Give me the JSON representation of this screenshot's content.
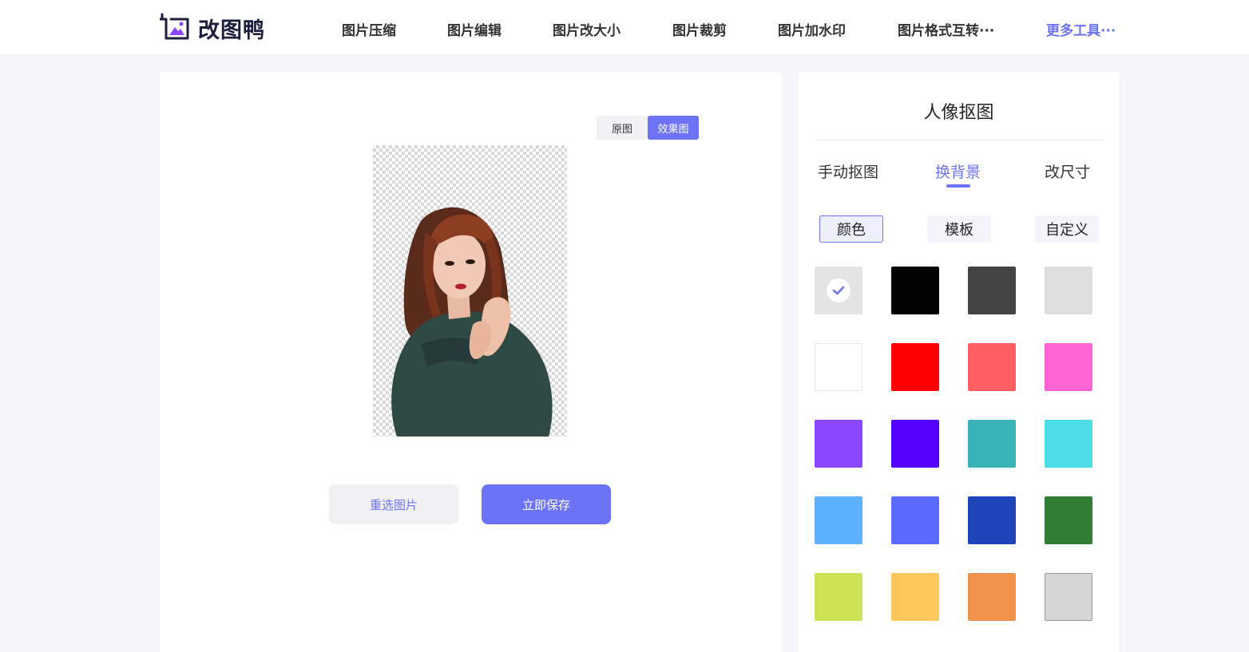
{
  "brand": {
    "name": "改图鸭"
  },
  "nav": {
    "items": [
      "图片压缩",
      "图片编辑",
      "图片改大小",
      "图片裁剪",
      "图片加水印",
      "图片格式互转···"
    ],
    "more": "更多工具···"
  },
  "preview": {
    "toggle": {
      "original": "原图",
      "result": "效果图",
      "active": "效果图"
    },
    "reselect_label": "重选图片",
    "save_label": "立即保存"
  },
  "panel": {
    "title": "人像抠图",
    "tabs": [
      "手动抠图",
      "换背景",
      "改尺寸"
    ],
    "active_tab": "换背景",
    "subtabs": [
      "颜色",
      "模板",
      "自定义"
    ],
    "active_subtab": "颜色",
    "swatches": [
      "transparent",
      "#000000",
      "#444444",
      "#dedede",
      "#ffffff",
      "#ff0000",
      "#ff5f61",
      "#ff63d4",
      "#8b47ff",
      "#5600ff",
      "#3ab3b8",
      "#4ddde6",
      "#5db1fe",
      "#5b6bff",
      "#1a44b8",
      "#2e7d32",
      "#cde157",
      "#fec75c",
      "#f0914a",
      "#d6d6d6"
    ],
    "selected_swatch": "transparent"
  },
  "colors": {
    "accent": "#6c73f7",
    "brand_text": "#1b1e3d"
  }
}
